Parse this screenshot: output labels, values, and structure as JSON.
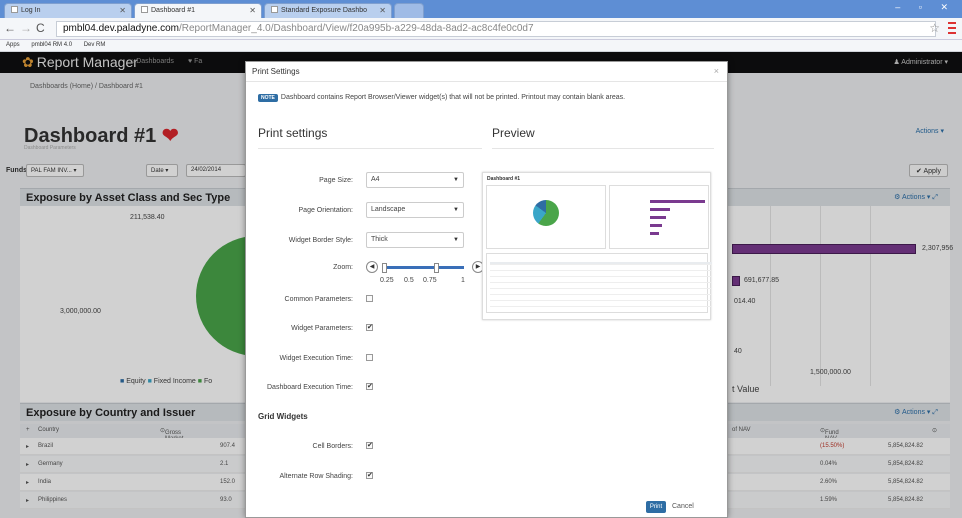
{
  "browser": {
    "tabs": [
      {
        "label": "Log In"
      },
      {
        "label": "Dashboard #1"
      },
      {
        "label": "Standard Exposure Dashbo"
      }
    ],
    "url_domain": "pmbl04.dev.paladyne.com",
    "url_rest": "/ReportManager_4.0/Dashboard/View/f20a995b-a229-48da-8ad2-ac8c4fe0c0d7",
    "bookmarks": [
      "Apps",
      "pmbl04 RM 4.0",
      "Dev RM"
    ]
  },
  "app": {
    "logo": "Report Manager",
    "nav_dashboards": "Dashboards",
    "nav_fav": "Fa",
    "user": "Administrator"
  },
  "page": {
    "breadcrumb": "Dashboards (Home)  /  Dashboard #1",
    "title": "Dashboard #1",
    "subtitle": "Dashboard Parameters",
    "actions": "Actions",
    "funds_label": "Funds",
    "funds_value": "PAL FAM INV...",
    "date_label": "Date",
    "date_value": "24/02/2014",
    "apply": "Apply"
  },
  "widget1": {
    "title": "Exposure by Asset Class and Sec Type",
    "actions": "Actions",
    "label_top": "211,538.40",
    "label_left": "3,000,000.00",
    "legend_equity": "Equity",
    "legend_fixed": "Fixed Income",
    "legend_f": "Fo",
    "bar_values": [
      "2,307,956",
      "691,677.85",
      "014.40",
      "40"
    ],
    "axis_tick": "1,500,000.00",
    "axis_label": "t Value"
  },
  "widget2": {
    "title": "Exposure by Country and Issuer",
    "actions": "Actions",
    "columns": [
      "Country",
      "Gross Market Value",
      "of NAV",
      "Fund NAV"
    ],
    "rows": [
      {
        "country": "Brazil",
        "gmv": "907.4",
        "pct": "(15.50%)",
        "nav": "5,854,824.82",
        "neg": true
      },
      {
        "country": "Germany",
        "gmv": "2.1",
        "pct": "0.04%",
        "nav": "5,854,824.82",
        "neg": false
      },
      {
        "country": "India",
        "gmv": "152.0",
        "pct": "2.60%",
        "nav": "5,854,824.82",
        "neg": false
      },
      {
        "country": "Philippines",
        "gmv": "93.0",
        "pct": "1.59%",
        "nav": "5,854,824.82",
        "neg": false
      }
    ]
  },
  "modal": {
    "title": "Print Settings",
    "note_badge": "NOTE",
    "note_text": "Dashboard contains Report Browser/Viewer widget(s) that will not be printed. Printout may contain blank areas.",
    "settings_title": "Print settings",
    "preview_title": "Preview",
    "page_size_label": "Page Size:",
    "page_size_value": "A4",
    "orientation_label": "Page Orientation:",
    "orientation_value": "Landscape",
    "border_label": "Widget Border Style:",
    "border_value": "Thick",
    "zoom_label": "Zoom:",
    "zoom_value": 0.75,
    "zoom_ticks": [
      "0.25",
      "0.5",
      "0.75",
      "1"
    ],
    "common_label": "Common Parameters:",
    "common_checked": false,
    "widget_params_label": "Widget Parameters:",
    "widget_params_checked": true,
    "exec_label": "Widget Execution Time:",
    "exec_checked": false,
    "dash_exec_label": "Dashboard Execution Time:",
    "dash_exec_checked": true,
    "grid_widgets": "Grid Widgets",
    "cell_borders_label": "Cell Borders:",
    "cell_borders_checked": true,
    "alt_shading_label": "Alternate Row Shading:",
    "alt_shading_checked": true,
    "print": "Print",
    "cancel": "Cancel",
    "preview_doc_title": "Dashboard #1"
  }
}
